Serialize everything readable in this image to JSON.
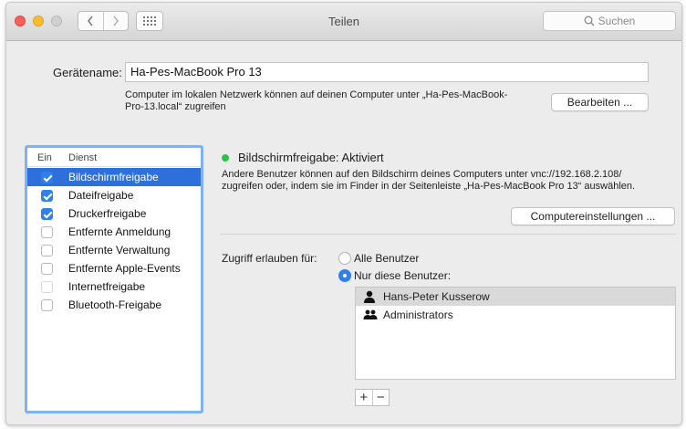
{
  "window": {
    "title": "Teilen"
  },
  "search": {
    "placeholder": "Suchen"
  },
  "computer_name": {
    "label": "Gerätename:",
    "value": "Ha-Pes-MacBook Pro 13",
    "hint_line1": "Computer im lokalen Netzwerk können auf deinen Computer unter „Ha-Pes-MacBook-",
    "hint_line2": "Pro-13.local“ zugreifen",
    "edit_button": "Bearbeiten ..."
  },
  "services": {
    "header_on": "Ein",
    "header_service": "Dienst",
    "items": [
      {
        "label": "Bildschirmfreigabe",
        "checked": true,
        "selected": true
      },
      {
        "label": "Dateifreigabe",
        "checked": true,
        "selected": false
      },
      {
        "label": "Druckerfreigabe",
        "checked": true,
        "selected": false
      },
      {
        "label": "Entfernte Anmeldung",
        "checked": false,
        "selected": false
      },
      {
        "label": "Entfernte Verwaltung",
        "checked": false,
        "selected": false
      },
      {
        "label": "Entfernte Apple-Events",
        "checked": false,
        "selected": false
      },
      {
        "label": "Internetfreigabe",
        "checked": false,
        "selected": false,
        "disabled": true
      },
      {
        "label": "Bluetooth-Freigabe",
        "checked": false,
        "selected": false
      }
    ]
  },
  "detail": {
    "status_color": "#2fc146",
    "status_text": "Bildschirmfreigabe: Aktiviert",
    "description_line1": "Andere Benutzer können auf den Bildschirm deines Computers unter vnc://192.168.2.108/",
    "description_line2": "zugreifen oder, indem sie im Finder in der Seitenleiste „Ha-Pes-MacBook Pro 13“ auswählen.",
    "settings_button": "Computereinstellungen ...",
    "access_label": "Zugriff erlauben für:",
    "option_all": "Alle Benutzer",
    "option_only": "Nur diese Benutzer:",
    "selected_option": "Nur diese Benutzer:",
    "users": [
      {
        "name": "Hans-Peter Kusserow",
        "icon": "user-icon",
        "selected": true
      },
      {
        "name": "Administrators",
        "icon": "group-icon",
        "selected": false
      }
    ],
    "add_symbol": "+",
    "remove_symbol": "−"
  },
  "colors": {
    "accent": "#2f80ee",
    "selection": "#2d6fdb"
  }
}
